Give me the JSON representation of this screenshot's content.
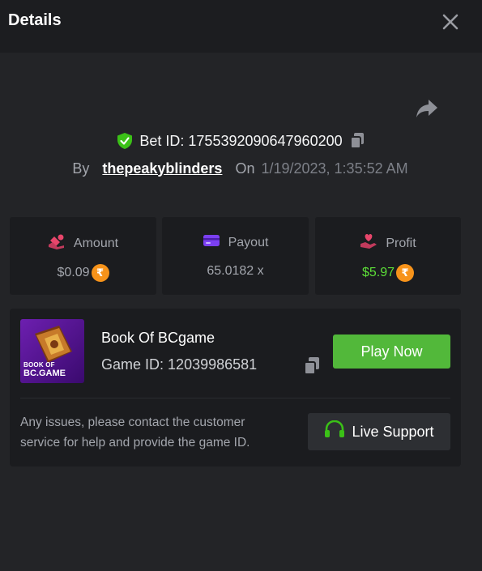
{
  "header": {
    "title": "Details"
  },
  "bet": {
    "id_label": "Bet ID:",
    "id_value": "1755392090647960200",
    "by_label": "By",
    "username": "thepeakyblinders",
    "on_label": "On",
    "datetime": "1/19/2023, 1:35:52 AM"
  },
  "stats": [
    {
      "label": "Amount",
      "value": "$0.09",
      "icon": "hand-money-icon",
      "value_color": "#a3a6ad",
      "coin": true
    },
    {
      "label": "Payout",
      "value": "65.0182 x",
      "icon": "card-icon",
      "value_color": "#a3a6ad",
      "coin": false
    },
    {
      "label": "Profit",
      "value": "$5.97",
      "icon": "hand-heart-icon",
      "value_color": "#5ddf38",
      "coin": true
    }
  ],
  "coin_symbol": "₹",
  "game": {
    "name": "Book Of BCgame",
    "id_label": "Game ID:",
    "id_value": "12039986581",
    "thumb_text_top": "BOOK OF",
    "thumb_text_bottom": "BC.GAME",
    "play_label": "Play Now"
  },
  "support": {
    "message": "Any issues, please contact the customer service for help and provide the game ID.",
    "button_label": "Live Support"
  },
  "colors": {
    "accent_green": "#52b83a",
    "profit_green": "#5ddf38",
    "shield_green": "#3bc117",
    "coin_orange": "#f7931a"
  }
}
